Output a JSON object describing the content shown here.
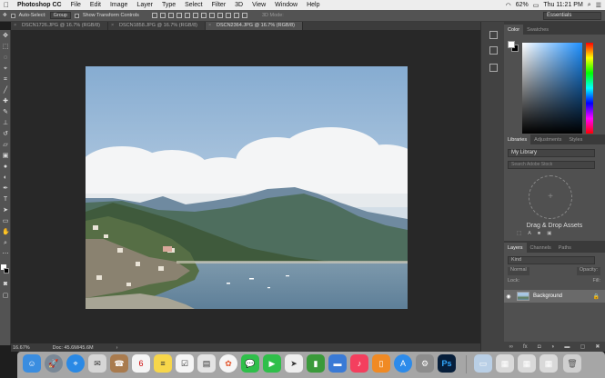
{
  "menubar": {
    "apple": "",
    "items": [
      "Photoshop CC",
      "File",
      "Edit",
      "Image",
      "Layer",
      "Type",
      "Select",
      "Filter",
      "3D",
      "View",
      "Window",
      "Help"
    ],
    "battery": "62%",
    "clock": "Thu 11:21 PM"
  },
  "options": {
    "auto_select": "Auto-Select:",
    "group": "Group",
    "transform": "Show Transform Controls",
    "mode3d": "3D Mode:",
    "workspace": "Essentials"
  },
  "tabs": [
    {
      "label": "DSCN1726.JPG @ 16.7% (RGB/8)"
    },
    {
      "label": "DSCN1858.JPG @ 16.7% (RGB/8)"
    },
    {
      "label": "DSCN2364.JPG @ 16.7% (RGB/8)"
    }
  ],
  "status": {
    "zoom": "16.67%",
    "doc": "Doc: 45.6M/45.6M"
  },
  "color_panel": {
    "tabs": [
      "Color",
      "Swatches"
    ]
  },
  "libraries_panel": {
    "tabs": [
      "Libraries",
      "Adjustments",
      "Styles"
    ],
    "library": "My Library",
    "search_placeholder": "Search Adobe Stock",
    "drop_label": "Drag & Drop Assets"
  },
  "layers_panel": {
    "tabs": [
      "Layers",
      "Channels",
      "Paths"
    ],
    "kind": "Kind",
    "blend": "Normal",
    "opacity": "Opacity:",
    "lock": "Lock:",
    "fill": "Fill:",
    "layer_name": "Background"
  },
  "colors": {
    "panel": "#535353",
    "dark": "#282828",
    "accent": "#31a8ff"
  }
}
